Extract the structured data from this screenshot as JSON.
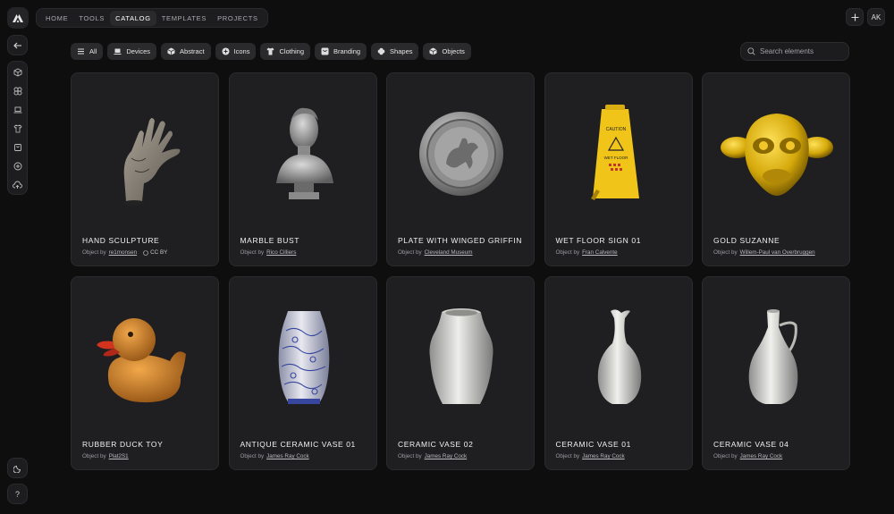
{
  "topnav": {
    "items": [
      {
        "label": "HOME"
      },
      {
        "label": "TOOLS"
      },
      {
        "label": "CATALOG",
        "active": true
      },
      {
        "label": "TEMPLATES"
      },
      {
        "label": "PROJECTS"
      }
    ],
    "plus_icon": "plus-icon",
    "avatar_initials": "AK"
  },
  "sidebar": {
    "icons": [
      "back-arrow-icon",
      "cube-icon",
      "shapes-icon",
      "laptop-icon",
      "shirt-icon",
      "branding-icon",
      "plus-circle-icon",
      "cloud-upload-icon"
    ],
    "bottom": [
      "moon-icon",
      "help-icon"
    ],
    "help_label": "?"
  },
  "filters": [
    {
      "label": "All",
      "icon": "menu-icon"
    },
    {
      "label": "Devices",
      "icon": "laptop-icon"
    },
    {
      "label": "Abstract",
      "icon": "cube-icon"
    },
    {
      "label": "Icons",
      "icon": "plus-circle-icon"
    },
    {
      "label": "Clothing",
      "icon": "shirt-icon"
    },
    {
      "label": "Branding",
      "icon": "branding-icon"
    },
    {
      "label": "Shapes",
      "icon": "shapes-icon"
    },
    {
      "label": "Objects",
      "icon": "cube-icon"
    }
  ],
  "search": {
    "placeholder": "Search elements"
  },
  "cards": [
    {
      "title": "HAND SCULPTURE",
      "by": "Object by",
      "author": "re1monsen",
      "license": "CC BY",
      "thumb": "hand"
    },
    {
      "title": "MARBLE BUST",
      "by": "Object by",
      "author": "Rico Cilliers",
      "thumb": "bust"
    },
    {
      "title": "PLATE WITH WINGED GRIFFIN",
      "by": "Object by",
      "author": "Cleveland Museum",
      "thumb": "plate"
    },
    {
      "title": "WET FLOOR SIGN 01",
      "by": "Object by",
      "author": "Fran Calvente",
      "thumb": "sign"
    },
    {
      "title": "GOLD SUZANNE",
      "by": "Object by",
      "author": "Willem-Paul van Overbruggen",
      "thumb": "suzanne"
    },
    {
      "title": "RUBBER DUCK TOY",
      "by": "Object by",
      "author": "Plat2S1",
      "thumb": "duck"
    },
    {
      "title": "ANTIQUE CERAMIC VASE 01",
      "by": "Object by",
      "author": "James Ray Cock",
      "thumb": "blue-vase"
    },
    {
      "title": "CERAMIC VASE 02",
      "by": "Object by",
      "author": "James Ray Cock",
      "thumb": "vase2"
    },
    {
      "title": "CERAMIC VASE 01",
      "by": "Object by",
      "author": "James Ray Cock",
      "thumb": "vase1"
    },
    {
      "title": "CERAMIC VASE 04",
      "by": "Object by",
      "author": "James Ray Cock",
      "thumb": "vase4"
    }
  ],
  "sign_text": {
    "caution": "CAUTION",
    "wet_floor": "WET FLOOR"
  },
  "colors": {
    "background": "#0e0e0f",
    "card": "#1f1f21",
    "chip": "#2a2a2c",
    "gold": "#d4a80a",
    "duck": "#d98b2b",
    "sign": "#f0c419"
  }
}
